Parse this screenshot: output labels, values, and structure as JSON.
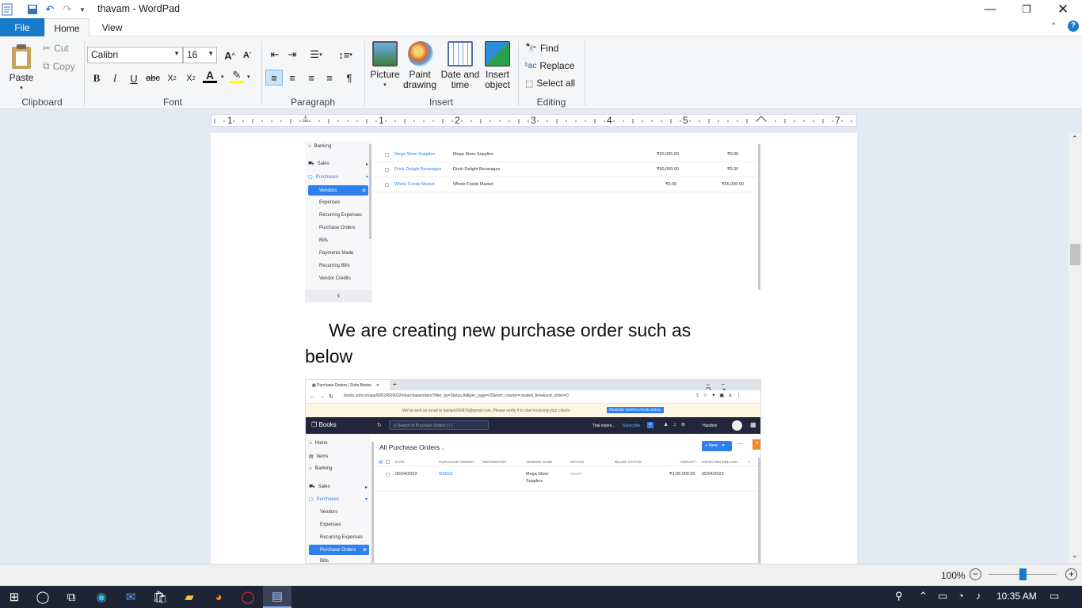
{
  "window": {
    "title": "thavam - WordPad"
  },
  "tabs": {
    "file": "File",
    "home": "Home",
    "view": "View"
  },
  "clipboard": {
    "paste": "Paste",
    "cut": "Cut",
    "copy": "Copy",
    "label": "Clipboard"
  },
  "font": {
    "family": "Calibri",
    "size": "16",
    "label": "Font"
  },
  "paragraph": {
    "label": "Paragraph"
  },
  "insert": {
    "picture": "Picture",
    "paint_drawing": "Paint drawing",
    "date_time": "Date and time",
    "insert_object": "Insert object",
    "label": "Insert"
  },
  "editing": {
    "find": "Find",
    "replace": "Replace",
    "select_all": "Select all",
    "label": "Editing"
  },
  "ruler": {
    "numbers": [
      "1",
      "1",
      "2",
      "3",
      "4",
      "5",
      "6",
      "7"
    ]
  },
  "document": {
    "paragraph_line1": "We are creating new purchase order such as",
    "paragraph_line2": "below"
  },
  "shot1": {
    "sidebar": {
      "banking": "Banking",
      "sales": "Sales",
      "purchases": "Purchases",
      "vendors": "Vendors",
      "expenses": "Expenses",
      "recurring_expenses": "Recurring Expenses",
      "purchase_orders": "Purchase Orders",
      "bills": "Bills",
      "payments_made": "Payments Made",
      "recurring_bills": "Recurring Bills",
      "vendor_credits": "Vendor Credits",
      "collapse": "‹"
    },
    "rows": [
      {
        "name": "Mega Store Supplies",
        "company": "Mega Store Supplies",
        "payables": "₹50,000.00",
        "credits": "₹0.00"
      },
      {
        "name": "Drink Delight Bevarages",
        "company": "Drink Delight Bevarages",
        "payables": "₹50,000.00",
        "credits": "₹0.00"
      },
      {
        "name": "Whole Foods Market",
        "company": "Whole Foods Market",
        "payables": "₹0.00",
        "credits": "₹55,000.00"
      }
    ]
  },
  "shot2": {
    "browser_tab": "Purchase Orders | Zoho Books",
    "new_tab": "+",
    "url": "books.zoho.in/app/60024509032#/purchaseorders?filter_by=Status.All&per_page=25&sort_column=created_time&sort_order=D",
    "banner_text": "We've sent an email to kaviani260676@gmail.com. Please verify it to start invoicing your clients.",
    "banner_button": "RESEND VERIFICATION EMAIL",
    "app_name": "Books",
    "search_placeholder": "Search in Purchase Orders ( / )",
    "trial": "Trial expire...",
    "subscribe": "Subscribe",
    "user": "Harshini",
    "page_title": "All Purchase Orders",
    "new_button": "+ New",
    "help": "?",
    "columns": [
      "DATE",
      "PURCHASE ORDER#",
      "REFERENCE#",
      "VENDOR NAME",
      "STATUS",
      "BILLED STATUS",
      "AMOUNT",
      "EXPECTED DELIVER..."
    ],
    "row": {
      "date": "05/04/2023",
      "po": "000001",
      "reference": "",
      "vendor_line1": "Mega Store",
      "vendor_line2": "Supplies",
      "status": "DRAFT",
      "billed": "",
      "amount": "₹1,00,000.00",
      "expected": "05/04/2023"
    },
    "sidebar": {
      "home": "Home",
      "items": "Items",
      "banking": "Banking",
      "sales": "Sales",
      "purchases": "Purchases",
      "vendors": "Vendors",
      "expenses": "Expenses",
      "recurring_expenses": "Recurring Expenses",
      "purchase_orders": "Purchase Orders",
      "bills": "Bills"
    }
  },
  "status": {
    "zoom": "100%",
    "zoom_level": 0.5
  },
  "taskbar": {
    "time": "10:35 AM"
  }
}
